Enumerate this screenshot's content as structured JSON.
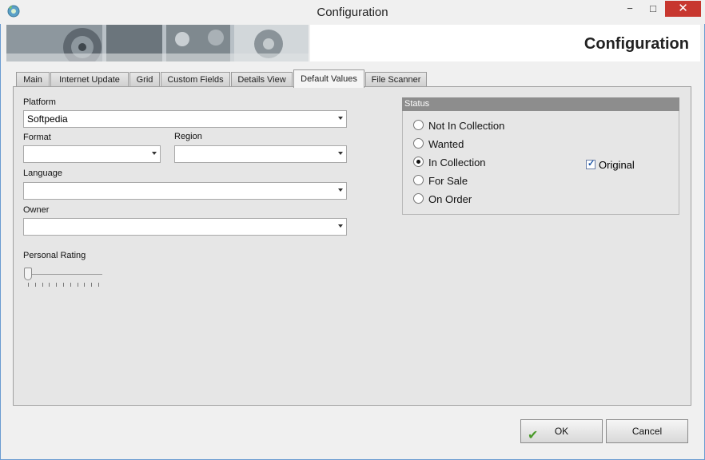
{
  "window": {
    "title": "Configuration",
    "minimize_glyph": "−",
    "maximize_glyph": "□",
    "close_glyph": "✕"
  },
  "header": {
    "title": "Configuration"
  },
  "tabs": [
    {
      "label": "Main"
    },
    {
      "label": "Internet Update"
    },
    {
      "label": "Grid"
    },
    {
      "label": "Custom Fields"
    },
    {
      "label": "Details View"
    },
    {
      "label": "Default Values",
      "active": true
    },
    {
      "label": "File Scanner"
    }
  ],
  "form": {
    "platform_label": "Platform",
    "platform_value": "Softpedia",
    "format_label": "Format",
    "format_value": "",
    "region_label": "Region",
    "region_value": "",
    "language_label": "Language",
    "language_value": "",
    "owner_label": "Owner",
    "owner_value": "",
    "rating_label": "Personal Rating",
    "rating_value": 0
  },
  "status": {
    "title": "Status",
    "options": [
      {
        "label": "Not In Collection",
        "checked": false
      },
      {
        "label": "Wanted",
        "checked": false
      },
      {
        "label": "In Collection",
        "checked": true
      },
      {
        "label": "For Sale",
        "checked": false
      },
      {
        "label": "On Order",
        "checked": false
      }
    ],
    "original_label": "Original",
    "original_checked": true
  },
  "buttons": {
    "ok_label": "OK",
    "cancel_label": "Cancel"
  },
  "colors": {
    "close_button": "#c7372f",
    "status_header": "#8d8d8d",
    "window_border": "#6a9bd1"
  }
}
